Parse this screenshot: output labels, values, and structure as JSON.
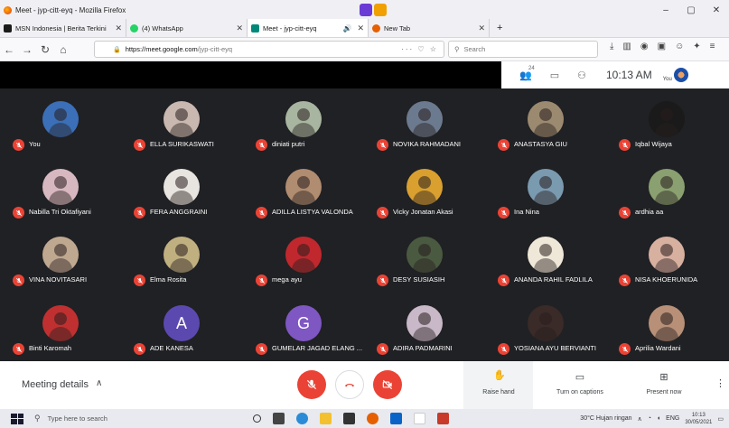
{
  "window": {
    "title": "Meet - jyp-citt-eyq - Mozilla Firefox",
    "controls": [
      "–",
      "▢",
      "✕"
    ]
  },
  "tabs": [
    {
      "label": "MSN Indonesia | Berita Terkini",
      "color": "#1b1b1b",
      "active": false
    },
    {
      "label": "(4) WhatsApp",
      "color": "#25d366",
      "active": false
    },
    {
      "label": "Meet - jyp-citt-eyq",
      "color": "#00897b",
      "active": true
    },
    {
      "label": "New Tab",
      "color": "#e66000",
      "active": false
    }
  ],
  "new_tab_symbol": "+",
  "nav": {
    "url_host": "https://meet.google.com",
    "url_path": "/jyp-citt-eyq",
    "url_right": "··· ♡ ☆",
    "search_placeholder": "Search"
  },
  "meet_top": {
    "participant_count": "24",
    "time": "10:13 AM",
    "you_label": "You"
  },
  "participants": [
    {
      "name": "You",
      "avatar": "#3b6fb8",
      "letter": ""
    },
    {
      "name": "ELLA SURIKASWATI",
      "avatar": "#c9b8b0",
      "letter": ""
    },
    {
      "name": "diniati putri",
      "avatar": "#a8b5a0",
      "letter": ""
    },
    {
      "name": "NOVIKA RAHMADANI",
      "avatar": "#6c7a8f",
      "letter": ""
    },
    {
      "name": "ANASTASYA GIU",
      "avatar": "#9c8a70",
      "letter": ""
    },
    {
      "name": "Iqbal Wijaya",
      "avatar": "#1a1a1a",
      "letter": ""
    },
    {
      "name": "Nabilla Tri Oktafiyani",
      "avatar": "#d8b8c0",
      "letter": ""
    },
    {
      "name": "FERA ANGGRAINI",
      "avatar": "#e8e4df",
      "letter": ""
    },
    {
      "name": "ADILLA LISTYA VALONDA",
      "avatar": "#b08c70",
      "letter": ""
    },
    {
      "name": "Vicky Jonatan Akasi",
      "avatar": "#d9a030",
      "letter": ""
    },
    {
      "name": "Ina Nina",
      "avatar": "#7a9ab0",
      "letter": ""
    },
    {
      "name": "ardhia aa",
      "avatar": "#8aa070",
      "letter": ""
    },
    {
      "name": "VINA NOVITASARI",
      "avatar": "#bfa890",
      "letter": ""
    },
    {
      "name": "Elma Rosita",
      "avatar": "#c0b080",
      "letter": ""
    },
    {
      "name": "mega ayu",
      "avatar": "#c0282e",
      "letter": ""
    },
    {
      "name": "DESY SUSIASIH",
      "avatar": "#4a5a40",
      "letter": ""
    },
    {
      "name": "ANANDA RAHIL FADLILA",
      "avatar": "#efe8d8",
      "letter": ""
    },
    {
      "name": "NISA KHOERUNIDA",
      "avatar": "#d8b0a0",
      "letter": ""
    },
    {
      "name": "Binti Karomah",
      "avatar": "#c03030",
      "letter": ""
    },
    {
      "name": "ADE KANESA",
      "avatar": "#5c49b0",
      "letter": "A"
    },
    {
      "name": "GUMELAR JAGAD ELANG ...",
      "avatar": "#7e57c2",
      "letter": "G"
    },
    {
      "name": "ADIRA PADMARINI",
      "avatar": "#c8b8c8",
      "letter": ""
    },
    {
      "name": "YOSIANA AYU BERVIANTI",
      "avatar": "#3a2a28",
      "letter": ""
    },
    {
      "name": "Aprilia Wardani",
      "avatar": "#b89078",
      "letter": ""
    }
  ],
  "controls": {
    "meeting_details": "Meeting details",
    "raise_hand": "Raise hand",
    "captions": "Turn on captions",
    "present": "Present now"
  },
  "taskbar": {
    "search_placeholder": "Type here to search",
    "weather": "30°C  Hujan ringan",
    "lang": "ENG",
    "time": "10:13",
    "date": "30/05/2021"
  },
  "colors": {
    "meet_bg": "#202124",
    "mute_red": "#ea4335",
    "taskbar": "#e8eaf0"
  }
}
